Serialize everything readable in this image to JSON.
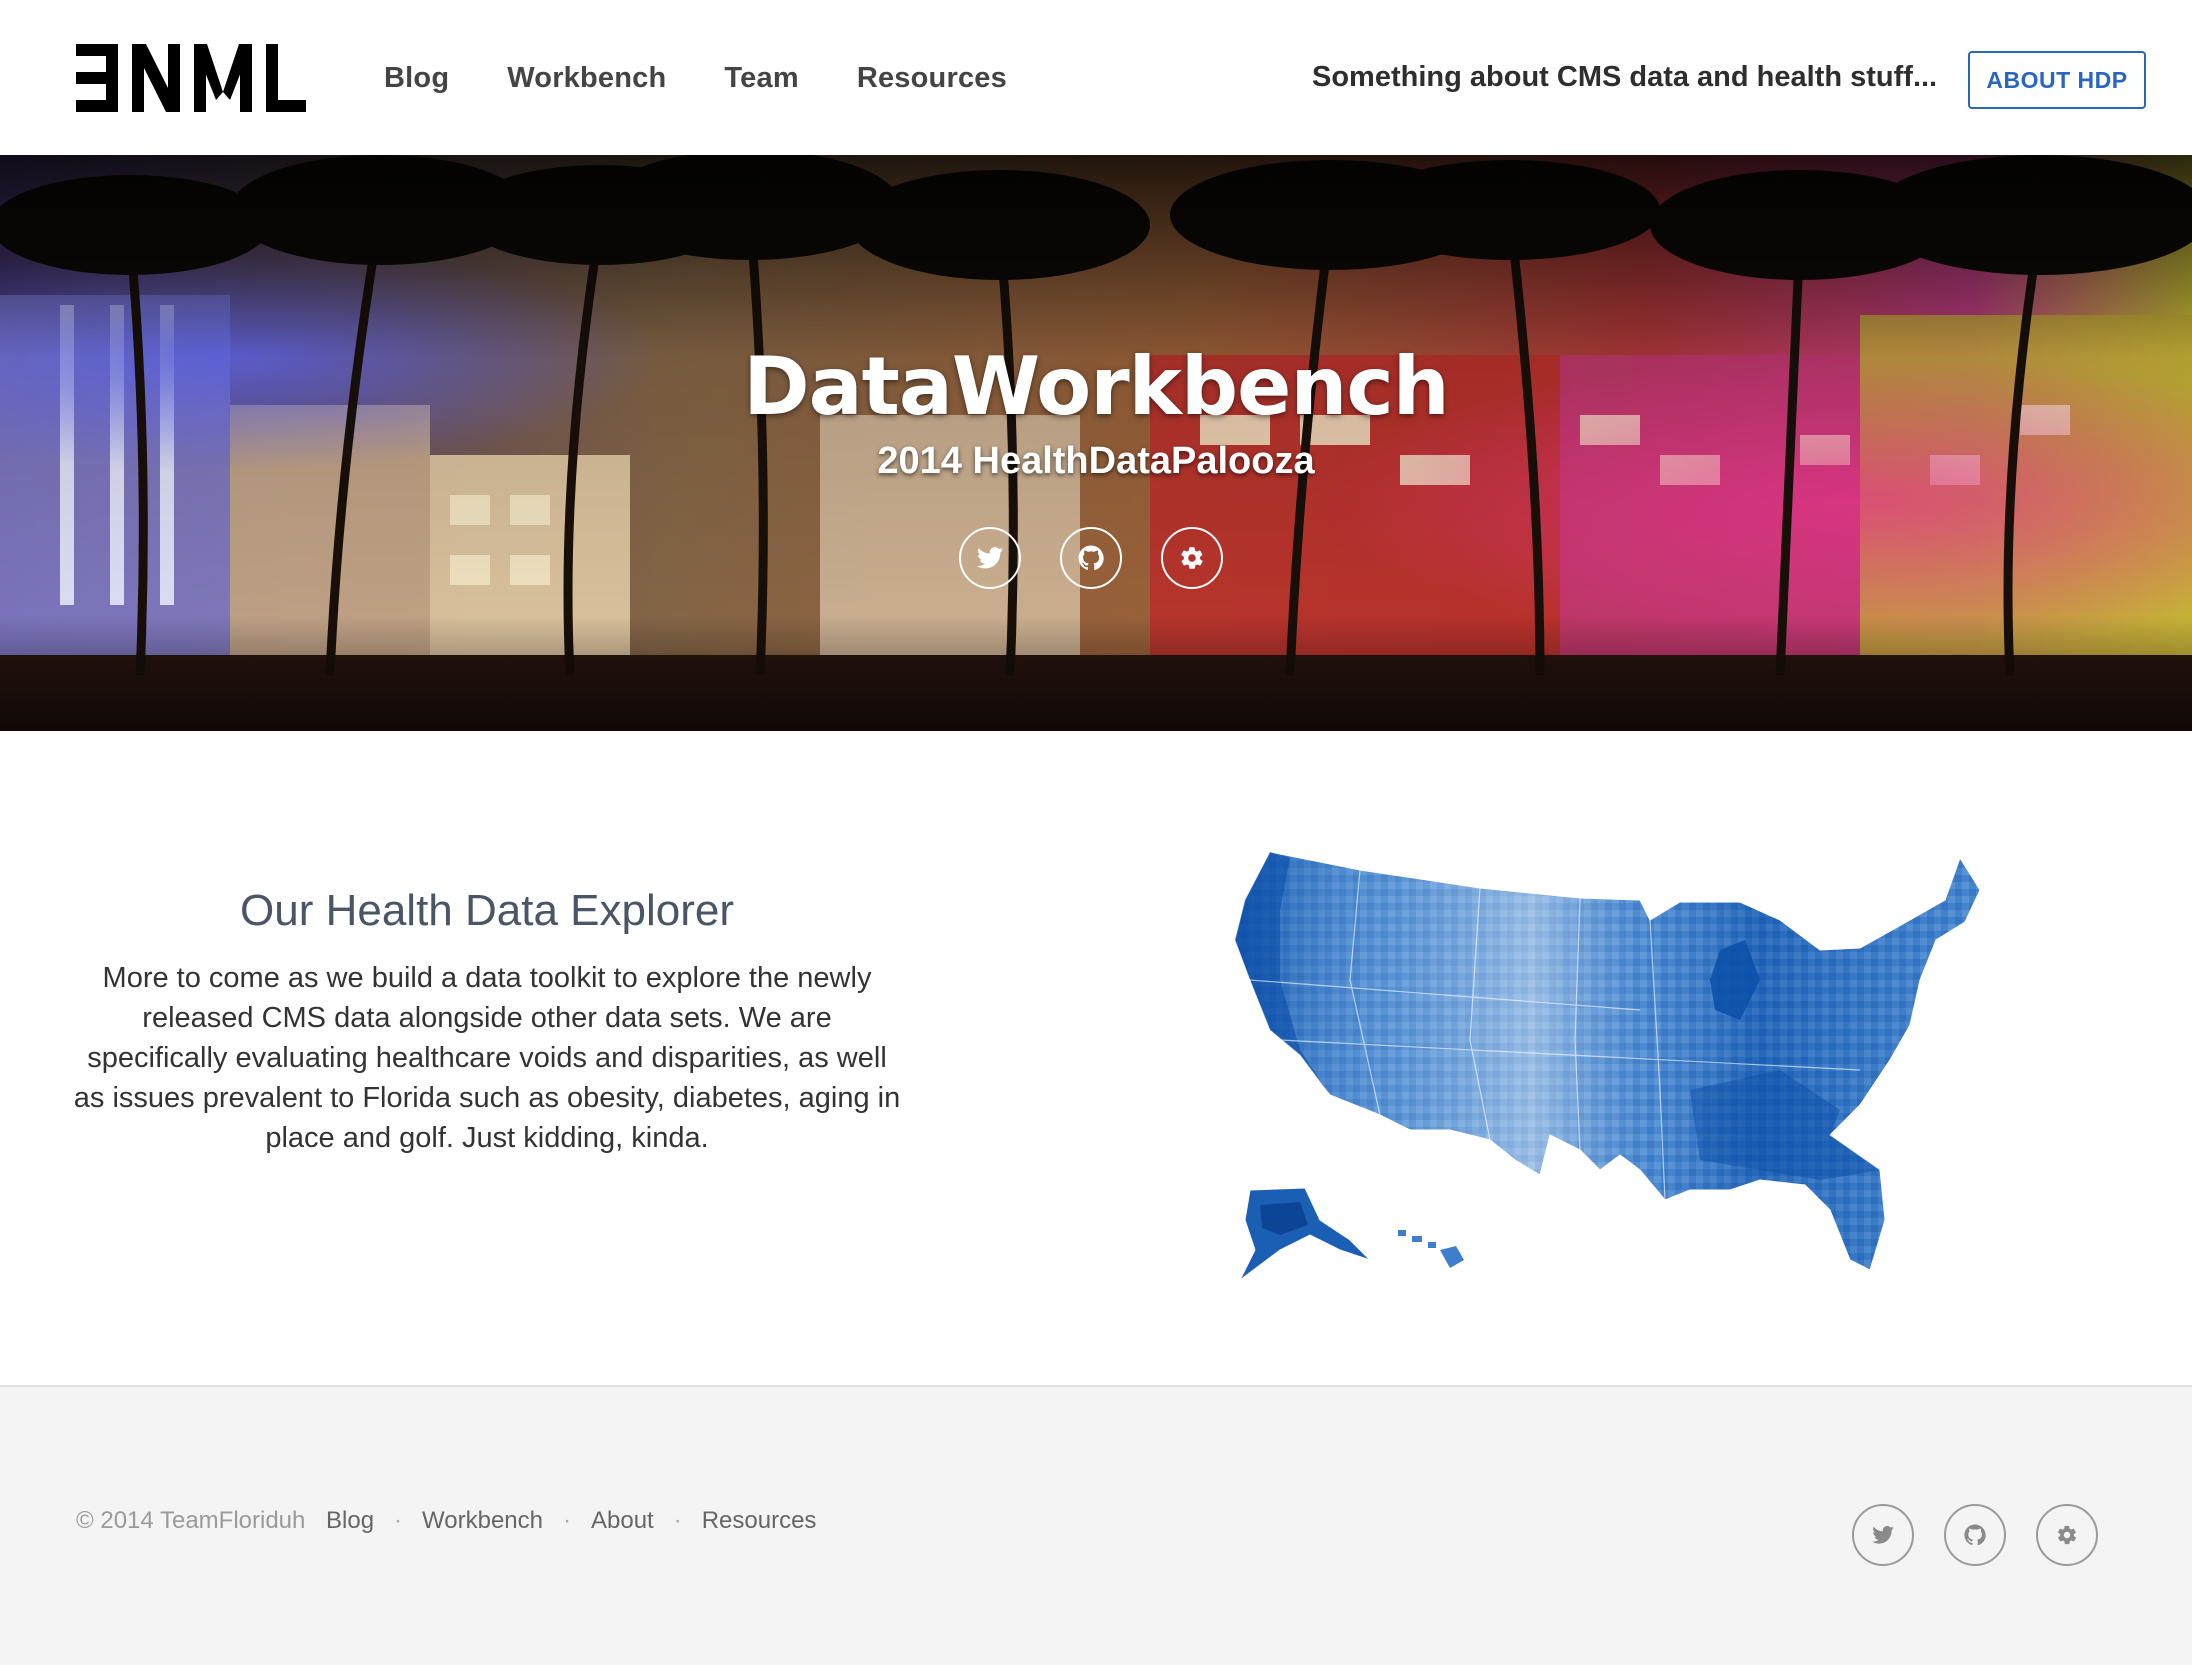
{
  "header": {
    "logo": "ƎNML",
    "nav": [
      "Blog",
      "Workbench",
      "Team",
      "Resources"
    ],
    "tagline": "Something about CMS data and health stuff...",
    "about_button": "ABOUT HDP"
  },
  "hero": {
    "title": "DataWorkbench",
    "subtitle": "2014 HealthDataPalooza",
    "icons": [
      "twitter-icon",
      "github-icon",
      "gear-icon"
    ]
  },
  "main": {
    "title": "Our Health Data Explorer",
    "text": "More to come as we build a data toolkit to explore the newly released CMS data alongside other data sets. We are specifically evaluating healthcare voids and disparities, as well as issues prevalent to Florida such as obesity, diabetes, aging in place and golf. Just kidding, kinda."
  },
  "footer": {
    "copyright": "© 2014 TeamFloriduh",
    "links": [
      "Blog",
      "Workbench",
      "About",
      "Resources"
    ],
    "icons": [
      "twitter-icon",
      "github-icon",
      "gear-icon"
    ]
  },
  "colors": {
    "accent": "#2866c1",
    "map_dark": "#0b4fa8",
    "map_light": "#bcd7f0"
  }
}
